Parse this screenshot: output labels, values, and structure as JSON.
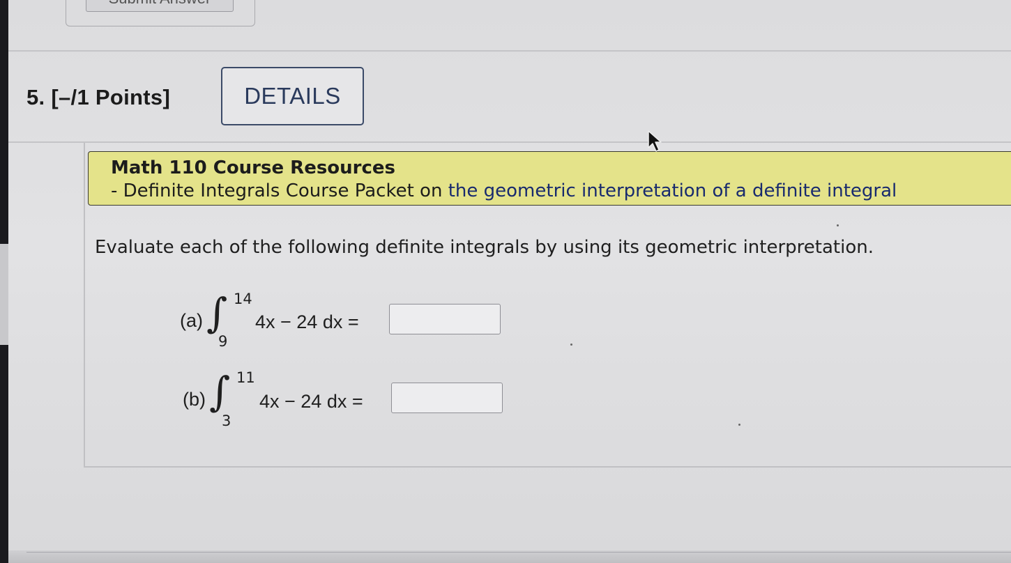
{
  "previous": {
    "button_label": "Submit Answer"
  },
  "question": {
    "number": "5.",
    "points": "[–/1 Points]",
    "details_label": "DETAILS"
  },
  "resources": {
    "title": "Math 110 Course Resources",
    "line_prefix": "- Definite Integrals Course Packet on ",
    "link_text": "the geometric interpretation of a definite integral"
  },
  "instructions": "Evaluate each of the following definite integrals by using its geometric interpretation.",
  "problems": [
    {
      "label": "(a)",
      "upper": "14",
      "lower": "9",
      "expression": "4x − 24 dx =",
      "answer": ""
    },
    {
      "label": "(b)",
      "upper": "11",
      "lower": "3",
      "expression": "4x − 24 dx =",
      "answer": ""
    }
  ],
  "icons": {
    "cursor": "mouse-pointer-icon",
    "integral": "integral-sign-icon"
  },
  "colors": {
    "resource_bg": "#e4e38a",
    "link": "#182a6e",
    "details_border": "#3b4a68"
  }
}
